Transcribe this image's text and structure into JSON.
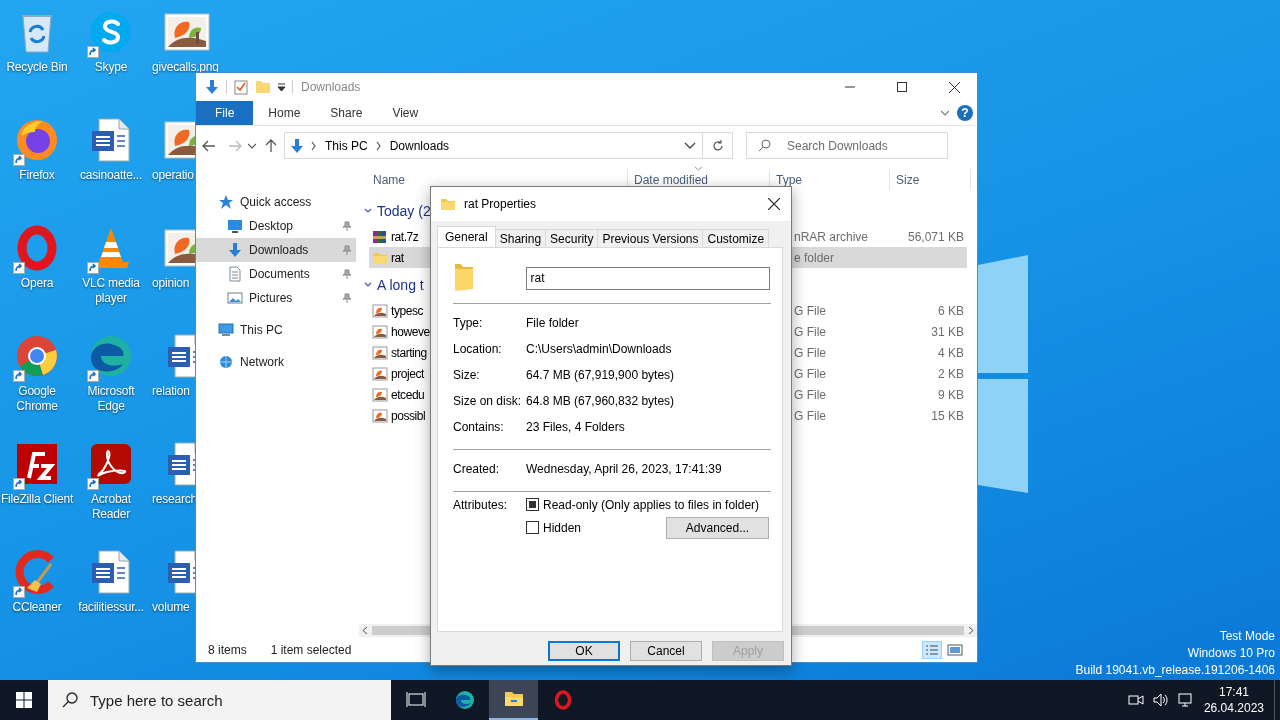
{
  "desktop": {
    "icons": [
      {
        "label": "Recycle Bin",
        "kind": "recycle",
        "shortcut": false
      },
      {
        "label": "Firefox",
        "kind": "firefox",
        "shortcut": true
      },
      {
        "label": "Opera",
        "kind": "opera",
        "shortcut": true
      },
      {
        "label": "Google Chrome",
        "kind": "chrome",
        "shortcut": true
      },
      {
        "label": "FileZilla Client",
        "kind": "filezilla",
        "shortcut": true
      },
      {
        "label": "CCleaner",
        "kind": "ccleaner",
        "shortcut": true
      },
      {
        "label": "Skype",
        "kind": "skype",
        "shortcut": true
      },
      {
        "label": "casinoatte...",
        "kind": "word",
        "shortcut": false
      },
      {
        "label": "VLC media player",
        "kind": "vlc",
        "shortcut": true
      },
      {
        "label": "Microsoft Edge",
        "kind": "edge",
        "shortcut": true
      },
      {
        "label": "Acrobat Reader",
        "kind": "acrobat",
        "shortcut": true
      },
      {
        "label": "facilitiessur...",
        "kind": "word",
        "shortcut": false
      },
      {
        "label": "givecalls.png",
        "kind": "image",
        "shortcut": false
      },
      {
        "label": "operatio",
        "kind": "image",
        "shortcut": false
      },
      {
        "label": "opinion",
        "kind": "image",
        "shortcut": false
      },
      {
        "label": "relation",
        "kind": "word",
        "shortcut": false
      },
      {
        "label": "research",
        "kind": "word",
        "shortcut": false
      },
      {
        "label": "volume",
        "kind": "word",
        "shortcut": false
      }
    ],
    "os_info": [
      "Test Mode",
      "Windows 10 Pro",
      "Build 19041.vb_release.191206-1406"
    ]
  },
  "explorer": {
    "title": "Downloads",
    "ribbon_tabs": [
      {
        "label": "File",
        "kind": "file"
      },
      {
        "label": "Home",
        "kind": "tab"
      },
      {
        "label": "Share",
        "kind": "tab"
      },
      {
        "label": "View",
        "kind": "tab"
      }
    ],
    "help": "?",
    "breadcrumb": [
      "This PC",
      "Downloads"
    ],
    "search": {
      "placeholder": "Search Downloads"
    },
    "nav": [
      {
        "label": "Quick access",
        "kind": "star",
        "selected": false,
        "children": [
          {
            "label": "Desktop",
            "kind": "desktop",
            "selected": false,
            "pinned": true
          },
          {
            "label": "Downloads",
            "kind": "download",
            "selected": true,
            "pinned": true
          },
          {
            "label": "Documents",
            "kind": "document",
            "selected": false,
            "pinned": true
          },
          {
            "label": "Pictures",
            "kind": "pictures",
            "selected": false,
            "pinned": true
          }
        ]
      },
      {
        "label": "This PC",
        "kind": "pc",
        "selected": false
      },
      {
        "label": "Network",
        "kind": "network",
        "selected": false
      }
    ],
    "columns": [
      "Name",
      "Date modified",
      "Type",
      "Size"
    ],
    "groups": [
      {
        "label": "Today (2",
        "expanded": true,
        "rows": [
          {
            "name": "rat.7z",
            "kind": "archive",
            "type": "nRAR archive",
            "size": "56,071 KB",
            "selected": false
          },
          {
            "name": "rat",
            "kind": "folder",
            "type": "e folder",
            "selected": true
          }
        ]
      },
      {
        "label": "A long t",
        "expanded": true,
        "rows": [
          {
            "name": "typesc",
            "kind": "image",
            "type": "G File",
            "size": "6 KB",
            "selected": false
          },
          {
            "name": "howeve",
            "kind": "image",
            "type": "G File",
            "size": "31 KB",
            "selected": false
          },
          {
            "name": "starting",
            "kind": "image",
            "type": "G File",
            "size": "4 KB",
            "selected": false
          },
          {
            "name": "project",
            "kind": "image",
            "type": "G File",
            "size": "2 KB",
            "selected": false
          },
          {
            "name": "etcedu",
            "kind": "image",
            "type": "G File",
            "size": "9 KB",
            "selected": false
          },
          {
            "name": "possibl",
            "kind": "image",
            "type": "G File",
            "size": "15 KB",
            "selected": false
          }
        ]
      }
    ],
    "status": {
      "count": "8 items",
      "selection": "1 item selected"
    }
  },
  "dialog": {
    "title": "rat Properties",
    "tabs": [
      {
        "label": "General",
        "selected": true
      },
      {
        "label": "Sharing",
        "selected": false
      },
      {
        "label": "Security",
        "selected": false
      },
      {
        "label": "Previous Versions",
        "selected": false
      },
      {
        "label": "Customize",
        "selected": false
      }
    ],
    "name": "rat",
    "sections": [
      [
        {
          "label": "Type:",
          "value": "File folder"
        },
        {
          "label": "Location:",
          "value": "C:\\Users\\admin\\Downloads"
        },
        {
          "label": "Size:",
          "value": "64.7 MB (67,919,900 bytes)"
        },
        {
          "label": "Size on disk:",
          "value": "64.8 MB (67,960,832 bytes)"
        },
        {
          "label": "Contains:",
          "value": "23 Files, 4 Folders"
        }
      ],
      [
        {
          "label": "Created:",
          "value": "Wednesday, April 26, 2023, 17:41:39"
        }
      ]
    ],
    "attributes_label": "Attributes:",
    "attributes": [
      {
        "label": "Read-only (Only applies to files in folder)",
        "checked": false,
        "mixed": true
      },
      {
        "label": "Hidden",
        "checked": false,
        "mixed": false
      }
    ],
    "advanced_button": "Advanced...",
    "buttons": [
      {
        "label": "OK",
        "kind": "default",
        "disabled": false
      },
      {
        "label": "Cancel",
        "kind": "normal",
        "disabled": false
      },
      {
        "label": "Apply",
        "kind": "normal",
        "disabled": true
      }
    ]
  },
  "taskbar": {
    "search": {
      "placeholder": "Type here to search"
    },
    "apps": [
      {
        "kind": "taskview",
        "active": false
      },
      {
        "kind": "edge",
        "active": false
      },
      {
        "kind": "explorer",
        "active": true
      },
      {
        "kind": "opera",
        "active": false
      }
    ],
    "clock": {
      "time": "17:41",
      "date": "26.04.2023"
    }
  }
}
